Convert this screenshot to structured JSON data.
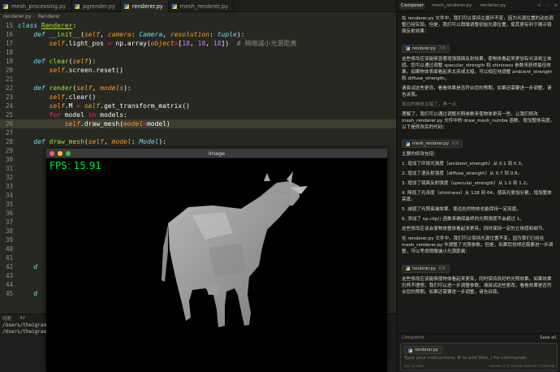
{
  "tabs": [
    {
      "label": "mesh_processing.py",
      "active": false
    },
    {
      "label": "pgrender.py",
      "active": false
    },
    {
      "label": "renderer.py",
      "active": true
    },
    {
      "label": "mesh_renderer.py",
      "active": false
    }
  ],
  "breadcrumb": {
    "file": "renderer.py",
    "symbol": "Renderer"
  },
  "code_lines": [
    {
      "n": "15",
      "html": "<span class=\"kw\">class</span> <span class=\"cls\">Renderer</span>:"
    },
    {
      "n": "16",
      "html": "    <span class=\"kw\">def</span> <span class=\"fn\">__init__</span>(<span class=\"self\">self</span>, <span class=\"pm\">camera</span>: <span class=\"ty\">Camera</span>, <span class=\"pm\">resolution</span>: <span class=\"ty\">tuple</span>):"
    },
    {
      "n": "17",
      "html": "        <span class=\"self\">self</span>.light_pos <span class=\"kw2\">=</span> np.array(<span class=\"pm\">object</span><span class=\"kw2\">=</span>[<span class=\"num\">18</span>, <span class=\"num\">18</span>, <span class=\"num\">18</span>])  <span class=\"cm\"># 稍微减小光源距离</span>"
    },
    {
      "n": "18",
      "html": ""
    },
    {
      "n": "19",
      "html": "    <span class=\"kw\">def</span> <span class=\"fn\">clear</span>(<span class=\"self\">self</span>):"
    },
    {
      "n": "20",
      "html": "        <span class=\"self\">self</span>.screen.reset()"
    },
    {
      "n": "21",
      "html": ""
    },
    {
      "n": "22",
      "html": "    <span class=\"kw\">def</span> <span class=\"fn\">render</span>(<span class=\"self\">self</span>, <span class=\"pm\">models</span>):"
    },
    {
      "n": "23",
      "html": "        <span class=\"self\">self</span>.clear()"
    },
    {
      "n": "24",
      "html": "        <span class=\"self\">self</span>.M <span class=\"kw2\">=</span> <span class=\"self\">self</span>.get_transform_matrix()"
    },
    {
      "n": "25",
      "html": "        <span class=\"kw2\">for</span> model <span class=\"kw2\">in</span> models:"
    },
    {
      "n": "26",
      "html": "            <span class=\"self\">self</span>.draw_mesh(<span class=\"pm\">model</span><span class=\"kw2\">=</span>model)"
    },
    {
      "n": "27",
      "html": ""
    },
    {
      "n": "28",
      "html": "    <span class=\"kw\">def</span> <span class=\"fn\">draw_mesh</span>(<span class=\"self\">self</span>, <span class=\"pm\">model</span>: <span class=\"ty\">Model</span>):"
    },
    {
      "n": "29",
      "html": ""
    },
    {
      "n": "30",
      "html": ""
    },
    {
      "n": "31",
      "html": ""
    },
    {
      "n": "32",
      "html": ""
    },
    {
      "n": "33",
      "html": ""
    },
    {
      "n": "34",
      "html": ""
    },
    {
      "n": "35",
      "html": ""
    },
    {
      "n": "36",
      "html": ""
    },
    {
      "n": "37",
      "html": ""
    },
    {
      "n": "38",
      "html": ""
    },
    {
      "n": "39",
      "html": ""
    },
    {
      "n": "40",
      "html": ""
    },
    {
      "n": "41",
      "html": ""
    },
    {
      "n": "42",
      "html": "    <span class=\"kw\">d</span>"
    },
    {
      "n": "43",
      "html": ""
    },
    {
      "n": "44",
      "html": ""
    },
    {
      "n": "45",
      "html": "    <span class=\"kw\">d</span>"
    }
  ],
  "panel": {
    "tabs": [
      "问题",
      "42",
      "输出",
      "调试控制台",
      "终端",
      "端口"
    ],
    "lines": [
      "/Users/theigrams",
      "/Users/theigrams"
    ]
  },
  "image_window": {
    "title": "Image",
    "fps": "FPS: 15.91"
  },
  "ai_panel": {
    "tabs": [
      "Composer",
      "mesh_renderer.py",
      "renderer.py"
    ],
    "p1": "在 renderer.py 文件中，我们可以保持主循环不变，因为光源位置的动态调整已经实现。但是，我们可以稍微调整初始光源位置，使其更有利于展示镜面反射效果：",
    "chip1": {
      "file": "renderer.py",
      "meta": "7/8"
    },
    "p2": "这些修改应该能够显著增强镜面反射效果，使物体看起来更加有光泽和立体感。您可以通过调整 specular_strength 和 shininess 参数来获得最佳效果。如果物体表面看起来太亮或太暗，可以相应地调整 ambient_strength 和 diffuse_strength。",
    "p3": "请尝试这些更改，看看效果是否符合您的预期。如果还需要进一步调整，请告诉我。",
    "p4": "现在的物体太暗了，再一点",
    "p5": "理解了，我们可以通过调整光照参数来使物体更亮一些。让我们修改 mesh_renderer.py 文件中的 draw_mesh_numba 函数，增加整体亮度。以下是修改后的代码：",
    "chip2": {
      "file": "mesh_renderer.py",
      "meta": "6/6"
    },
    "p6": "主要的修改包括：",
    "list": [
      "1. 增加了环境光强度（ambient_strength）从 0.1 到 0.3。",
      "2. 增加了漫反射强度（diffuse_strength）从 0.7 到 0.8。",
      "3. 增加了镜面反射强度（specular_strength）从 1.0 到 1.2。",
      "4. 降低了光泽度（shininess）从 128 到 64，使高光更加分散，增加整体亮度。",
      "5. 减弱了光照衰减效果，使远处的物体也能保持一定亮度。",
      "6. 添加了 np.clip() 函数来确保最终的光照强度不会超过 1。"
    ],
    "p7": "这些修改应该会使物体整体看起来更亮，同时保持一定的立体感和细节。",
    "p8": "在 renderer.py 文件中，我们可以保持光源位置不变，因为我们已经在 mesh_renderer.py 中调整了光照参数。但是，如果您觉得还需要进一步调整，可以考虑稍微减小光源距离：",
    "chip3": {
      "file": "renderer.py",
      "meta": "6/6"
    },
    "p9": "这些修改应该能够使物体看起来更亮，同时保持良好的光照效果。如果效果仍然不理想，我们可以进一步调整参数。请尝试这些更改，看看效果是否符合您的预期。如果还需要进一步调整，请告诉我。",
    "completed": "Completed",
    "save_all": "Save all",
    "input_chip": "renderer.py",
    "input_placeholder": "Type your instructions, # to add files, / for commands",
    "input_meta_left": "Esc to blur",
    "input_meta_right": "claude-3.5-sonnet   Submit   Continue"
  }
}
